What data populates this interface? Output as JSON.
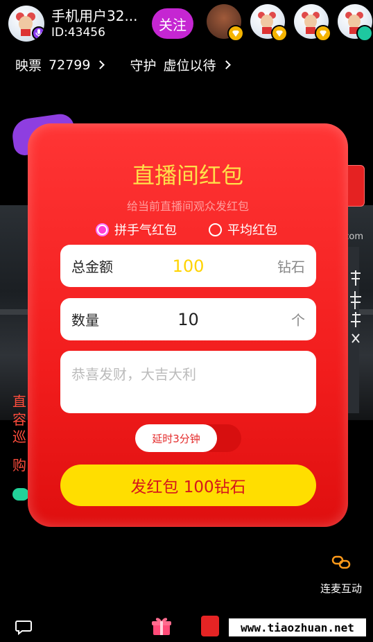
{
  "host": {
    "name": "手机用户32...",
    "id": "ID:43456",
    "follow_label": "关注"
  },
  "stats": {
    "tickets_label": "映票",
    "tickets_value": "72799",
    "guard_label": "守护",
    "guard_value": "虚位以待"
  },
  "redpacket": {
    "title": "直播间红包",
    "subtitle": "给当前直播间观众发红包",
    "option_lucky": "拼手气红包",
    "option_even": "平均红包",
    "selected_option": "拼手气红包",
    "amount_label": "总金额",
    "amount_value": "100",
    "amount_unit": "钻石",
    "count_label": "数量",
    "count_value": "10",
    "count_unit": "个",
    "message_placeholder": "恭喜发财，大吉大利",
    "delay_label": "延时3分钟",
    "send_label": "发红包 100钻石"
  },
  "background": {
    "side_text_1": "直",
    "side_text_2": "容",
    "side_text_3": "巡",
    "side_text_4": "购",
    "com_text": "com"
  },
  "interact": {
    "lianmai_label": "连麦互动"
  },
  "watermark": "www.tiaozhuan.net",
  "colors": {
    "modal_red": "#f21d1d",
    "title_yellow": "#ffe04a",
    "button_yellow": "#ffde00",
    "follow_purple": "#c526d2"
  }
}
